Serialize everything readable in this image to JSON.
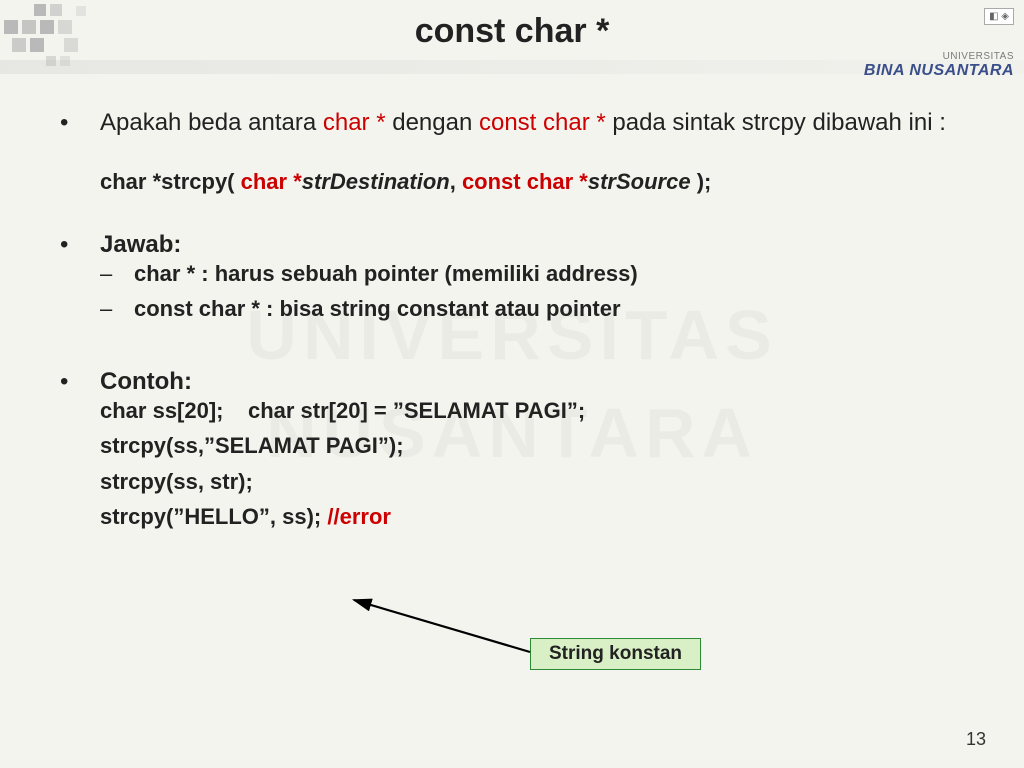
{
  "slide": {
    "title": "const char *",
    "page_number": "13"
  },
  "logo": {
    "universitas": "UNIVERSITAS",
    "name": "BINA NUSANTARA"
  },
  "question": {
    "pre1": "Apakah beda antara ",
    "kw1": "char *",
    "mid": " dengan ",
    "kw2": "const char *",
    "post": " pada sintak strcpy dibawah ini :"
  },
  "func": {
    "a": "char *strcpy( ",
    "b": "char *",
    "c": "strDestination",
    "d": ", ",
    "e": "const char *",
    "f": "strSource",
    "g": " );"
  },
  "answer": {
    "heading": "Jawab:",
    "line1": "char * : harus sebuah pointer (memiliki address)",
    "line2": "const char * : bisa string constant atau pointer"
  },
  "example": {
    "heading": "Contoh:",
    "l1": "char ss[20];    char str[20] = ”SELAMAT PAGI”;",
    "l2": "strcpy(ss,”SELAMAT PAGI”);",
    "l3": "strcpy(ss, str);",
    "l4a": "strcpy(”HELLO”, ss);  ",
    "l4b": "//error"
  },
  "callout": {
    "label": "String konstan"
  },
  "watermark": {
    "line1": "UNIVERSITAS",
    "line2": "NUSANTARA"
  }
}
